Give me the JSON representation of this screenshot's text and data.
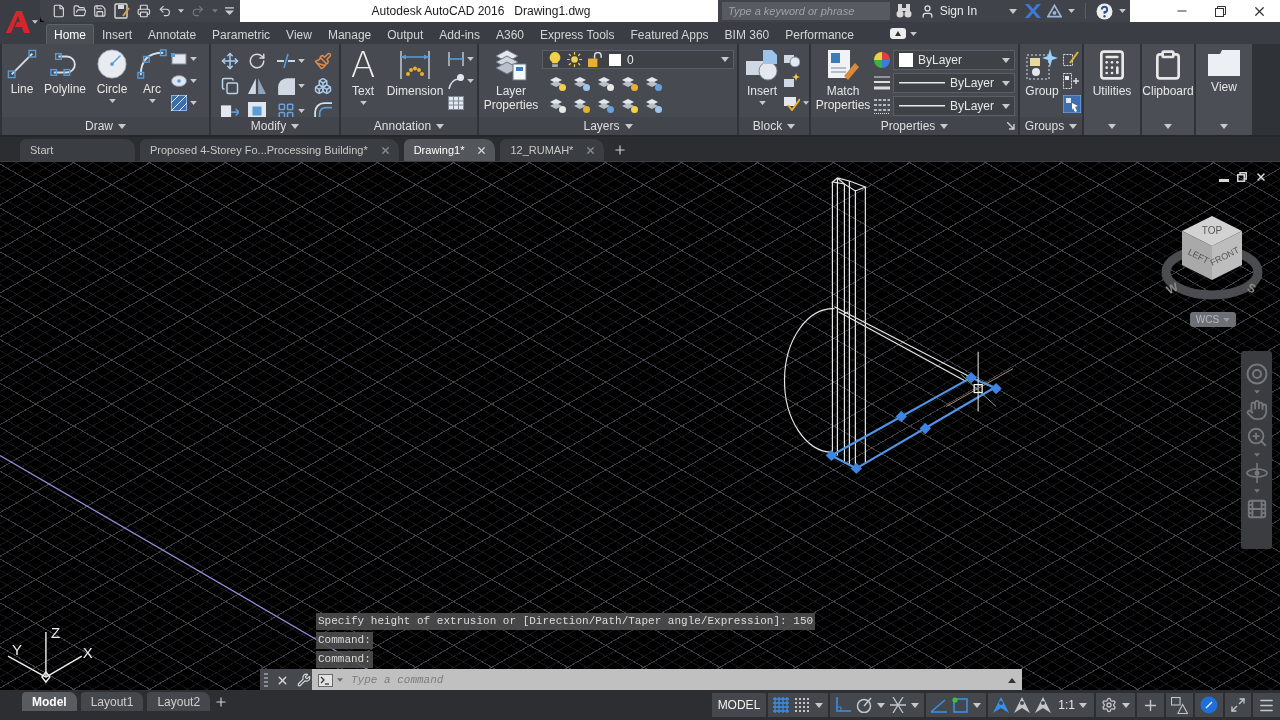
{
  "title_bar": {
    "quick_access": [
      {
        "kind": "new"
      },
      {
        "kind": "open"
      },
      {
        "kind": "save"
      },
      {
        "kind": "save_as"
      },
      {
        "kind": "plot"
      },
      {
        "kind": "undo",
        "disabled": false
      },
      {
        "kind": "redo",
        "disabled": true
      }
    ],
    "app_title": "Autodesk AutoCAD 2016",
    "document_title": "Drawing1.dwg",
    "search": {
      "placeholder": "Type a keyword or phrase"
    },
    "sign_in": "Sign In"
  },
  "ribbon_tabs": [
    {
      "label": "Home",
      "selected": true
    },
    {
      "label": "Insert",
      "selected": false
    },
    {
      "label": "Annotate",
      "selected": false
    },
    {
      "label": "Parametric",
      "selected": false
    },
    {
      "label": "View",
      "selected": false
    },
    {
      "label": "Manage",
      "selected": false
    },
    {
      "label": "Output",
      "selected": false
    },
    {
      "label": "Add-ins",
      "selected": false
    },
    {
      "label": "A360",
      "selected": false
    },
    {
      "label": "Express Tools",
      "selected": false
    },
    {
      "label": "Featured Apps",
      "selected": false
    },
    {
      "label": "BIM 360",
      "selected": false
    },
    {
      "label": "Performance",
      "selected": false
    }
  ],
  "ribbon": {
    "panels": [
      {
        "kind": "draw",
        "title": "Draw",
        "buttons": [
          "Line",
          "Polyline",
          "Circle",
          "Arc"
        ]
      },
      {
        "kind": "modify",
        "title": "Modify"
      },
      {
        "kind": "annotation",
        "title": "Annotation",
        "glyph": "A",
        "buttons": [
          "Text",
          "Dimension"
        ]
      },
      {
        "kind": "layers",
        "title": "Layers",
        "buttons": [
          "Layer Properties"
        ],
        "current_layer": "0"
      },
      {
        "kind": "block",
        "title": "Block",
        "buttons": [
          "Insert"
        ]
      },
      {
        "kind": "properties",
        "title": "Properties",
        "buttons": [
          "Match Properties"
        ],
        "color_setting": "ByLayer",
        "lineweight_setting": "ByLayer",
        "linetype_setting": "ByLayer"
      },
      {
        "kind": "groups",
        "title": "Groups",
        "buttons": [
          "Group"
        ],
        "selection_on": true
      },
      {
        "kind": "utilities",
        "buttons": [
          "Utilities"
        ]
      },
      {
        "kind": "clipboard",
        "buttons": [
          "Clipboard"
        ]
      },
      {
        "kind": "view",
        "buttons": [
          "View"
        ]
      }
    ]
  },
  "file_tabs": [
    {
      "label": "Start",
      "selected": false,
      "closable": false
    },
    {
      "label": "Proposed 4-Storey Fo...Processing Building*",
      "selected": false,
      "closable": true
    },
    {
      "label": "Drawing1*",
      "selected": true,
      "closable": true
    },
    {
      "label": "12_RUMAH*",
      "selected": false,
      "closable": true
    }
  ],
  "viewport": {
    "view_cube": {
      "faces": [
        "TOP",
        "LEFT",
        "FRONT"
      ],
      "compass": [
        "W",
        "S"
      ]
    },
    "ucs_menu": "WCS",
    "ucs_axes": [
      "X",
      "Y",
      "Z"
    ]
  },
  "command_history": [
    "Specify height of extrusion or [Direction/Path/Taper angle/Expression]: 150",
    "Command:",
    "Command:"
  ],
  "command_line": {
    "placeholder": "Type a command"
  },
  "layout_tabs": [
    {
      "label": "Model",
      "selected": true
    },
    {
      "label": "Layout1",
      "selected": false
    },
    {
      "label": "Layout2",
      "selected": false
    }
  ],
  "status_bar": {
    "space": "MODEL",
    "toggles": [
      {
        "kind": "grid",
        "on": true
      },
      {
        "kind": "snap",
        "on": false
      },
      {
        "kind": "ortho",
        "on": true
      },
      {
        "kind": "polar",
        "on": false
      },
      {
        "kind": "isodraft",
        "on": false
      },
      {
        "kind": "object_snap_tracking",
        "on": true
      },
      {
        "kind": "object_snap",
        "on": true
      },
      {
        "kind": "annotation_visibility",
        "on": true
      },
      {
        "kind": "auto_scale",
        "on": false
      },
      {
        "kind": "annotation_scale",
        "on": false
      }
    ],
    "annotation_scale": "1:1",
    "hardware_acceleration_on": true
  }
}
